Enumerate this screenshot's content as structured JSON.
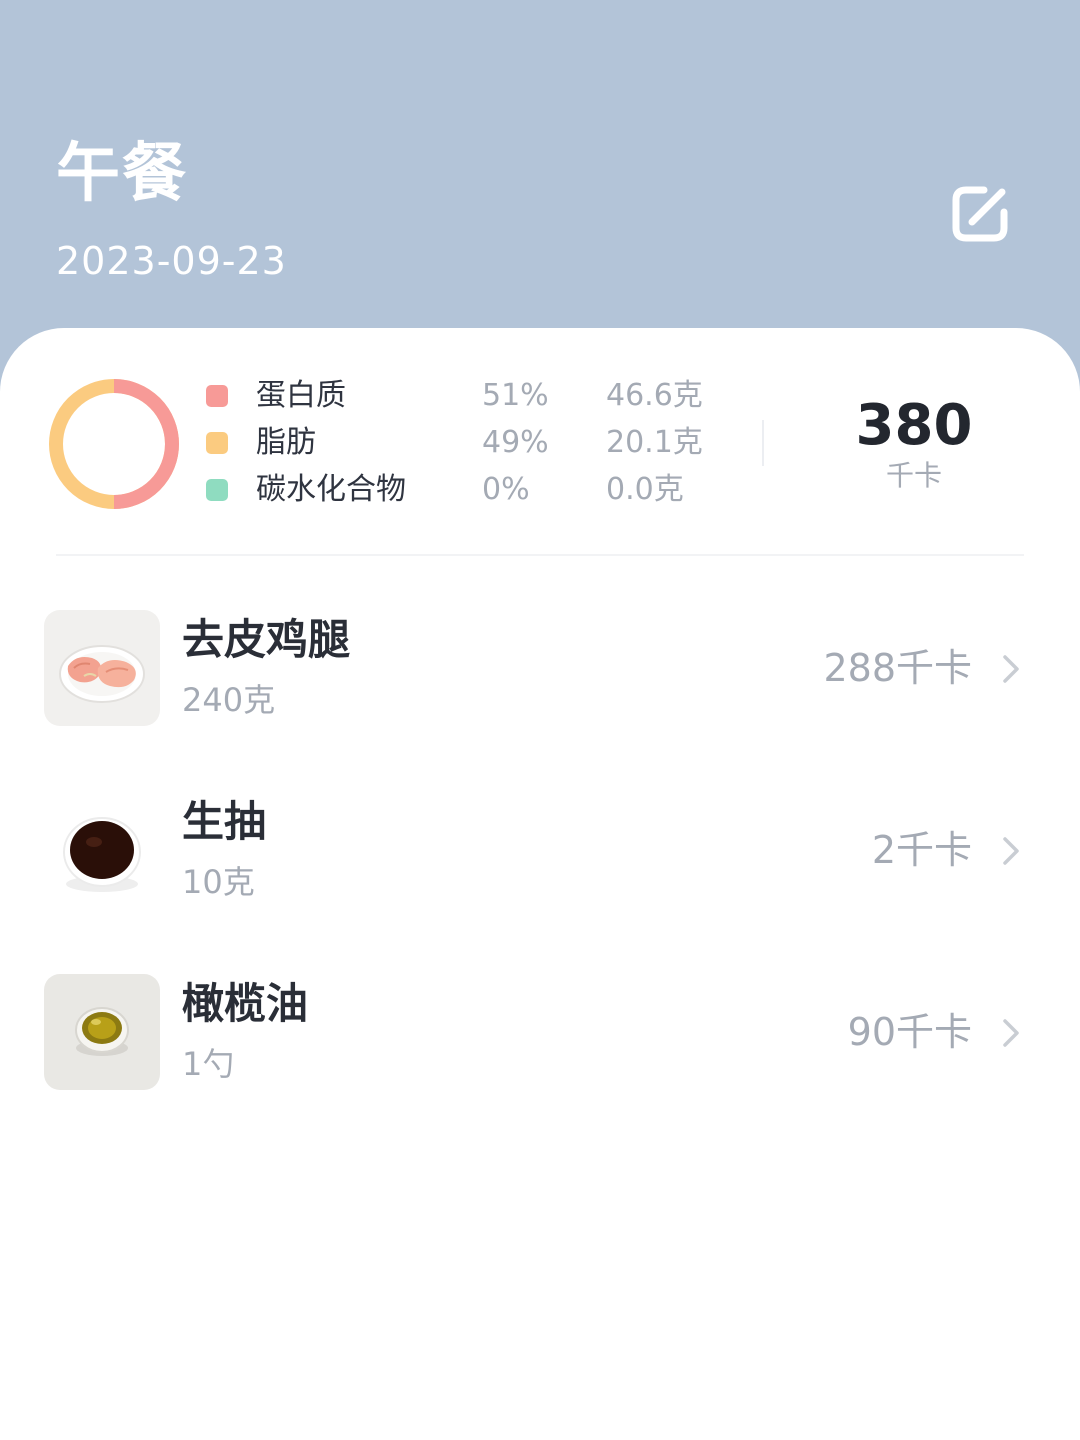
{
  "header": {
    "title": "午餐",
    "date": "2023-09-23"
  },
  "summary": {
    "macros": [
      {
        "name": "蛋白质",
        "percent": "51%",
        "amount": "46.6克",
        "color": "#f79a97"
      },
      {
        "name": "脂肪",
        "percent": "49%",
        "amount": "20.1克",
        "color": "#fbcb80"
      },
      {
        "name": "碳水化合物",
        "percent": "0%",
        "amount": "0.0克",
        "color": "#8fdcc0"
      }
    ],
    "total_kcal": "380",
    "total_unit": "千卡"
  },
  "foods": [
    {
      "name": "去皮鸡腿",
      "amount": "240克",
      "kcal": "288千卡",
      "thumb_icon": "chicken-leg-plate"
    },
    {
      "name": "生抽",
      "amount": "10克",
      "kcal": "2千卡",
      "thumb_icon": "soy-sauce-dish"
    },
    {
      "name": "橄榄油",
      "amount": "1勺",
      "kcal": "90千卡",
      "thumb_icon": "olive-oil-dish"
    }
  ],
  "colors": {
    "header_bg": "#b3c4d8",
    "protein": "#f79a97",
    "fat": "#fbcb80",
    "carbs": "#8fdcc0"
  }
}
